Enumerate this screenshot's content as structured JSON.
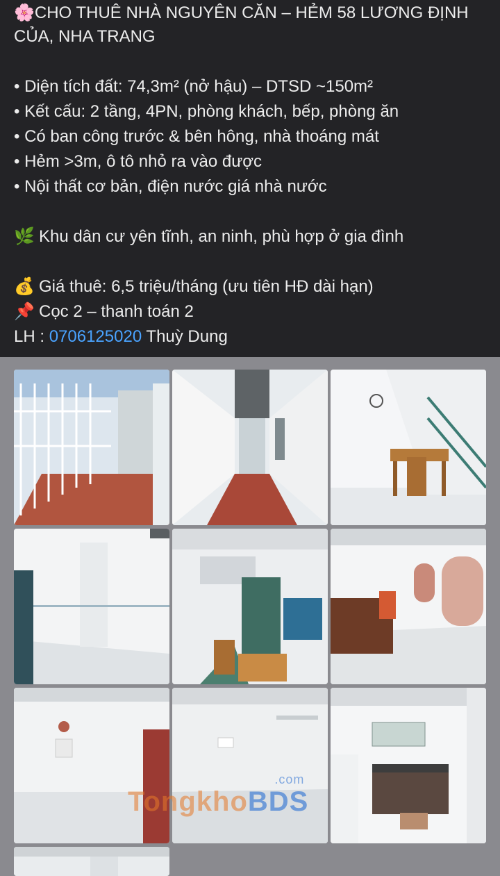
{
  "post": {
    "title_emoji": "🌸",
    "title_line1": "CHO THUÊ NHÀ NGUYÊN CĂN – HẺM 58 LƯƠNG ĐỊNH",
    "title_line2": "CỦA, NHA TRANG",
    "bullets": [
      "• Diện tích đất: 74,3m² (nở hậu) – DTSD ~150m²",
      "• Kết cấu: 2 tầng, 4PN, phòng khách, bếp, phòng ăn",
      "• Có ban công trước & bên hông, nhà thoáng mát",
      "• Hẻm >3m, ô tô nhỏ ra vào được",
      "• Nội thất cơ bản, điện nước giá nhà nước"
    ],
    "area_emoji": "🌿",
    "area_text": "Khu dân cư yên tĩnh, an ninh, phù hợp ở gia đình",
    "price_emoji": "💰",
    "price_text": "Giá thuê: 6,5 triệu/tháng (ưu tiên HĐ dài hạn)",
    "deposit_emoji": "📌",
    "deposit_text": "Cọc 2 – thanh toán 2",
    "contact_prefix": "LH : ",
    "contact_phone": "0706125020",
    "contact_name": " Thuỳ Dung"
  },
  "watermark": {
    "part1": "Tongkho",
    "part2": "BDS",
    "suffix": ".com"
  },
  "photos": [
    "balcony-photo",
    "corridor-photo",
    "dining-stairs-photo",
    "empty-room-photo-1",
    "overhead-room-photo",
    "bedroom-photo",
    "empty-room-photo-2",
    "empty-room-photo-3",
    "kitchen-photo",
    "partial-photo"
  ]
}
